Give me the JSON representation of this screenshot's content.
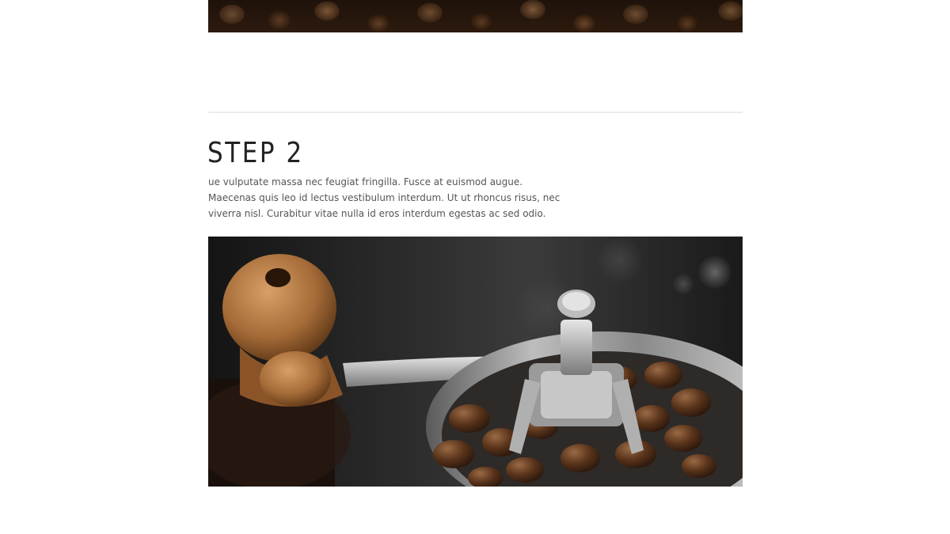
{
  "step": {
    "title": "STEP 2",
    "text_lines": [
      "ue vulputate massa nec feugiat fringilla. Fusce at euismod augue.",
      "Maecenas quis leo id lectus vestibulum interdum. Ut ut rhoncus risus, nec",
      "viverra nisl. Curabitur vitae nulla id eros interdum egestas ac sed odio."
    ]
  },
  "images": {
    "top": "coffee-beans-photo",
    "main": "coffee-grinder-photo"
  }
}
